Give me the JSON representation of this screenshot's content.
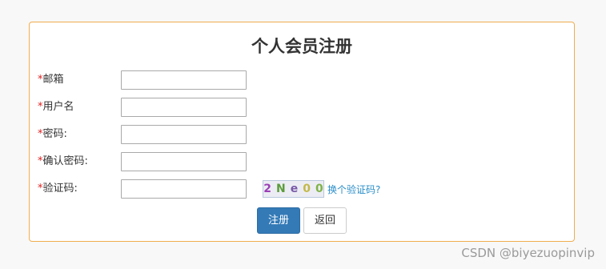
{
  "form": {
    "title": "个人会员注册",
    "required_mark": "*",
    "fields": [
      {
        "label": "邮箱",
        "value": ""
      },
      {
        "label": "用户名",
        "value": ""
      },
      {
        "label": "密码:",
        "value": ""
      },
      {
        "label": "确认密码:",
        "value": ""
      },
      {
        "label": "验证码:",
        "value": ""
      }
    ],
    "captcha": {
      "chars": [
        {
          "char": "2",
          "color": "#9b3fb5"
        },
        {
          "char": "N",
          "color": "#5b9c3a"
        },
        {
          "char": "e",
          "color": "#7a5aa8"
        },
        {
          "char": "0",
          "color": "#c4b84a"
        },
        {
          "char": "0",
          "color": "#7fb347"
        }
      ],
      "change_link": "换个验证码?"
    },
    "buttons": {
      "register": "注册",
      "back": "返回"
    }
  },
  "watermark": "CSDN @biyezuopinvip",
  "colors": {
    "panel_border": "#f0ad4e",
    "primary_button": "#337ab7",
    "required_mark": "#e02020",
    "link": "#2a8ec8"
  }
}
